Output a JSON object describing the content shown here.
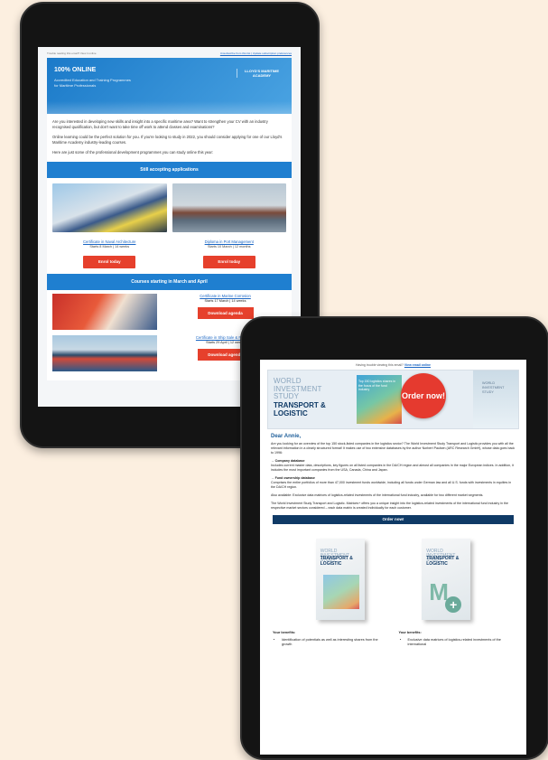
{
  "tablet1": {
    "preheader_left": "Trouble reading this email? View it online",
    "preheader_link": "Unsubscribe from this list | Update subscription preferences",
    "hero": {
      "title": "100% ONLINE",
      "subtitle": "Accredited Education and Training Programmes for Maritime Professionals",
      "logo": "LLOYD'S MARITIME ACADEMY"
    },
    "paragraphs": [
      "Are you interested in developing new skills and insight into a specific maritime area? Want to strengthen your CV with an industry recognised qualification, but don't want to take time off work to attend classes and examinations?",
      "Online learning could be the perfect solution for you. If you're looking to study in 2022, you should consider applying for one of our Lloyd's Maritime Academy industry-leading courses.",
      "Here are just some of the professional development programmes you can study online this year:"
    ],
    "band1": "Still accepting applications",
    "cards": [
      {
        "title": "Certificate in Naval Architecture",
        "meta": "Starts 8 March | 14 weeks",
        "button": "Enrol today"
      },
      {
        "title": "Diploma in Port Management",
        "meta": "Starts 10 March | 12 months",
        "button": "Enrol today"
      }
    ],
    "band2": "Courses starting in March and April",
    "rows": [
      {
        "title": "Certificate in Marine Corrosion",
        "meta": "Starts 17 March | 14 weeks",
        "button": "Download agenda"
      },
      {
        "title": "Certificate in Ship Sale & Purchase",
        "meta": "Starts 29 April | 12 weeks",
        "button": "Download agenda"
      }
    ]
  },
  "tablet2": {
    "preheader_text": "Having trouble viewing this email?",
    "preheader_link": "View email online",
    "banner": {
      "title_light": "WORLD INVESTMENT STUDY",
      "title_bold": "TRANSPORT & LOGISTIC",
      "mid_text": "Top 150 logistics shares in the focus of the fund industry",
      "order": "Order now!",
      "right_text": "WORLD INVESTMENT STUDY"
    },
    "greeting": "Dear Annie,",
    "paragraphs": [
      "Are you looking for an overview of the top 150 stock-listed companies in the logistics sector? The World Investment Study Transport and Logistic provides you with all the relevant information in a clearly structured format! It makes use of two extensive databases by the author Norbert Paulsen (ARC Research GmbH), whose data goes back to 1996:"
    ],
    "sections": [
      {
        "heading": "→ Company database",
        "text": "Includes current master data, descriptions, key figures on all listed companies in the DA/CH region and almost all companies in the major European indices. In addition, it includes the most important companies from the USA, Canada, China and Japan."
      },
      {
        "heading": "→ Fund ownership database",
        "text": "Comprises the entire portfolios of more than 47,000 investment funds worldwide, including all funds under German law and all U.S. funds with investments in equities in the DA/CH region."
      }
    ],
    "paragraphs_after": [
      "Also available: Exclusive data matrices of logistics-related investments of the international fund industry, available for two different market segments.",
      "The World Investment Study Transport and Logistic. Matrices+ offers you a unique insight into the logistics-related investments of the international fund industry in the respective market sectors considered – each data matrix is created individually for each customer."
    ],
    "order_band": "Order now!",
    "products": [
      {
        "t1": "WORLD INVESTMENT STUDY",
        "t2": "TRANSPORT & LOGISTIC"
      },
      {
        "t1": "WORLD INVESTMENT STUDY",
        "t2": "TRANSPORT & LOGISTIC",
        "badge": "M+"
      }
    ],
    "benefits": [
      {
        "heading": "Your benefits:",
        "item": "Identification of potentials as well as interesting shares from the growth"
      },
      {
        "heading": "Your benefits:",
        "item": "Exclusive data matrices of logistics-related investments of the international"
      }
    ]
  },
  "colors": {
    "background": "#fcefe0",
    "tablet": "#141414",
    "accent_blue": "#1f7fd0",
    "button_red": "#e6402c",
    "navy": "#0f3a66"
  }
}
